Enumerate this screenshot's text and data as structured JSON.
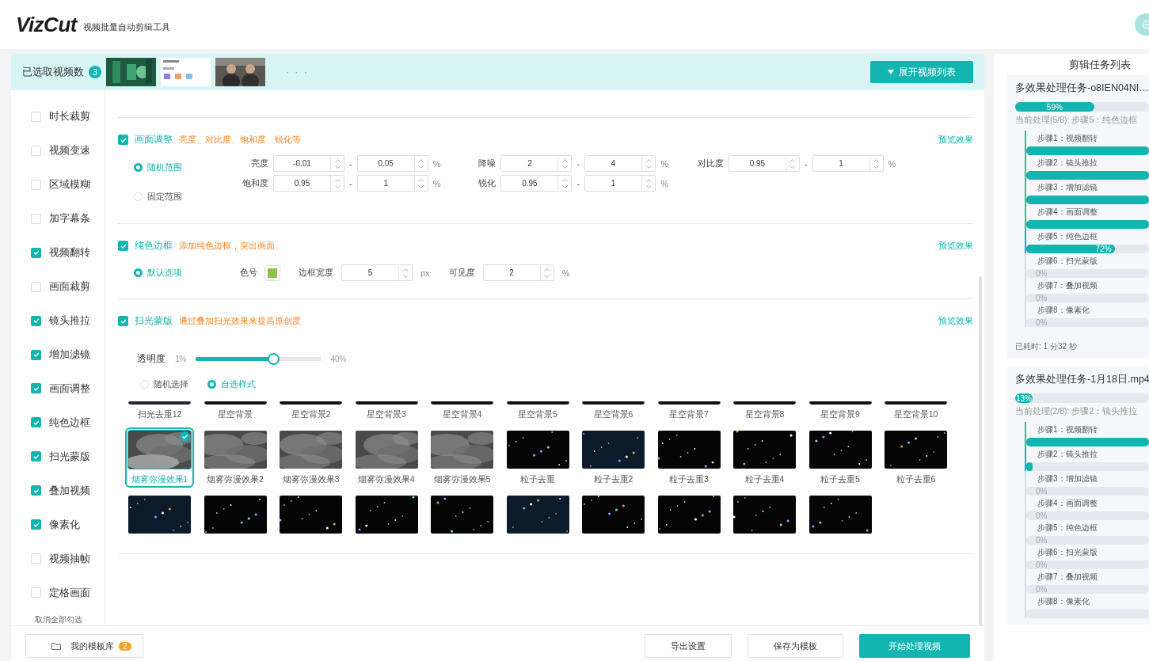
{
  "header": {
    "logo": "VizCut",
    "subtitle": "视频批量自动剪辑工具"
  },
  "selected_bar": {
    "label": "已选取视频数",
    "count": "3",
    "more": "· · ·",
    "expand_button": "展开视频列表"
  },
  "sidebar": {
    "items": [
      {
        "label": "时长裁剪",
        "checked": false
      },
      {
        "label": "视频变速",
        "checked": false
      },
      {
        "label": "区域模糊",
        "checked": false
      },
      {
        "label": "加字幕条",
        "checked": false
      },
      {
        "label": "视频翻转",
        "checked": true
      },
      {
        "label": "画面裁剪",
        "checked": false
      },
      {
        "label": "镜头推拉",
        "checked": true
      },
      {
        "label": "增加滤镜",
        "checked": true
      },
      {
        "label": "画面调整",
        "checked": true
      },
      {
        "label": "纯色边框",
        "checked": true
      },
      {
        "label": "扫光蒙版",
        "checked": true
      },
      {
        "label": "叠加视频",
        "checked": true
      },
      {
        "label": "像素化",
        "checked": true
      },
      {
        "label": "视频抽帧",
        "checked": false
      },
      {
        "label": "定格画面",
        "checked": false
      }
    ],
    "clear_all": "取消全部勾选"
  },
  "sections": [
    {
      "kind": "adjust",
      "checked": true,
      "title": "画面调整",
      "description": "亮度、对比度、饱和度、锐化等",
      "preview": "预览效果",
      "modes": [
        {
          "label": "随机范围",
          "selected": true
        },
        {
          "label": "固定范围",
          "selected": false
        }
      ],
      "params": [
        {
          "label": "亮度",
          "min": "-0.01",
          "separator": "-",
          "max": "0.05",
          "unit": "%"
        },
        {
          "label": "降噪",
          "min": "2",
          "separator": "-",
          "max": "4",
          "unit": "%"
        },
        {
          "label": "对比度",
          "min": "0.95",
          "separator": "-",
          "max": "1",
          "unit": "%"
        },
        {
          "label": "饱和度",
          "min": "0.95",
          "separator": "-",
          "max": "1",
          "unit": "%"
        },
        {
          "label": "锐化",
          "min": "0.95",
          "separator": "-",
          "max": "1",
          "unit": "%"
        }
      ]
    },
    {
      "kind": "border",
      "checked": true,
      "title": "纯色边框",
      "description": "添加纯色边框，突出画面",
      "preview": "预览效果",
      "modes": [
        {
          "label": "默认选项",
          "selected": true
        }
      ],
      "swatch": {
        "label": "色号",
        "color": "#8bc34a"
      },
      "fields": [
        {
          "label": "边框宽度",
          "value": "5",
          "unit": "px"
        },
        {
          "label": "可见度",
          "value": "2",
          "unit": "%"
        }
      ]
    },
    {
      "kind": "sweep",
      "checked": true,
      "title": "扫光蒙版",
      "description": "通过叠加扫光效果来提高原创度",
      "preview": "预览效果",
      "opacity": {
        "label": "透明度",
        "min": "1%",
        "max": "40%",
        "level": 0.62
      },
      "modes": [
        {
          "label": "随机选择",
          "selected": false
        },
        {
          "label": "自选样式",
          "selected": true
        }
      ],
      "styles": [
        {
          "kind": "cut",
          "label": "扫光去重12",
          "selected": false
        },
        {
          "kind": "cut",
          "label": "星空背景",
          "selected": false
        },
        {
          "kind": "cut",
          "label": "星空背景2",
          "selected": false
        },
        {
          "kind": "cut",
          "label": "星空背景3",
          "selected": false
        },
        {
          "kind": "cut",
          "label": "星空背景4",
          "selected": false
        },
        {
          "kind": "cut",
          "label": "星空背景5",
          "selected": false
        },
        {
          "kind": "cut",
          "label": "星空背景6",
          "selected": false
        },
        {
          "kind": "cut",
          "label": "星空背景7",
          "selected": false
        },
        {
          "kind": "cut",
          "label": "星空背景8",
          "selected": false
        },
        {
          "kind": "cut",
          "label": "星空背景9",
          "selected": false
        },
        {
          "kind": "cut",
          "label": "星空背景10",
          "selected": false
        },
        {
          "kind": "smoke",
          "label": "烟雾弥漫效果1",
          "selected": true
        },
        {
          "kind": "smoke",
          "label": "烟雾弥漫效果2",
          "selected": false
        },
        {
          "kind": "smoke",
          "label": "烟雾弥漫效果3",
          "selected": false
        },
        {
          "kind": "smoke",
          "label": "烟雾弥漫效果4",
          "selected": false
        },
        {
          "kind": "smoke",
          "label": "烟雾弥漫效果5",
          "selected": false
        },
        {
          "kind": "stars",
          "label": "粒子去重",
          "selected": false
        },
        {
          "kind": "stars",
          "label": "粒子去重2",
          "selected": false
        },
        {
          "kind": "stars",
          "label": "粒子去重3",
          "selected": false
        },
        {
          "kind": "stars",
          "label": "粒子去重4",
          "selected": false
        },
        {
          "kind": "stars",
          "label": "粒子去重5",
          "selected": false
        },
        {
          "kind": "stars",
          "label": "粒子去重6",
          "selected": false
        },
        {
          "kind": "stars",
          "selected": false
        },
        {
          "kind": "stars",
          "selected": false
        },
        {
          "kind": "stars",
          "selected": false
        },
        {
          "kind": "stars",
          "selected": false
        },
        {
          "kind": "stars",
          "selected": false
        },
        {
          "kind": "stars",
          "selected": false
        },
        {
          "kind": "stars",
          "selected": false
        },
        {
          "kind": "stars",
          "selected": false
        },
        {
          "kind": "stars",
          "selected": false
        },
        {
          "kind": "stars",
          "selected": false
        }
      ]
    }
  ],
  "bottom_bar": {
    "templates": {
      "label": "我的模板库",
      "count": "2"
    },
    "buttons": [
      {
        "label": "导出设置",
        "kind": "default"
      },
      {
        "label": "保存为模板",
        "kind": "default"
      },
      {
        "label": "开始处理视频",
        "kind": "primary"
      }
    ]
  },
  "task_panel": {
    "title": "剪辑任务列表",
    "tasks": [
      {
        "name": "多效果处理任务-o8IEN04NI…",
        "progress": {
          "level": 0.59,
          "reading": "59%"
        },
        "current": "当前处理(5/8): 步骤5：纯色边框",
        "steps": [
          {
            "label": "步骤1：视频翻转",
            "kind": "done",
            "level": 1
          },
          {
            "label": "步骤2：镜头推拉",
            "kind": "done",
            "level": 1
          },
          {
            "label": "步骤3：增加滤镜",
            "kind": "done",
            "level": 1
          },
          {
            "label": "步骤4：画面调整",
            "kind": "done",
            "level": 1
          },
          {
            "label": "步骤5：纯色边框",
            "kind": "active",
            "level": 0.72,
            "reading": "72%"
          },
          {
            "label": "步骤6：扫光蒙版",
            "kind": "pending",
            "level": 0,
            "reading": "0%"
          },
          {
            "label": "步骤7：叠加视频",
            "kind": "pending",
            "level": 0,
            "reading": "0%"
          },
          {
            "label": "步骤8：像素化",
            "kind": "pending",
            "level": 0,
            "reading": "0%"
          }
        ],
        "elapsed": "已耗时: 1 分32 秒"
      },
      {
        "name": "多效果处理任务-1月18日.mp4",
        "progress": {
          "level": 0.13,
          "reading": "13%"
        },
        "current": "当前处理(2/8): 步骤2：镜头推拉",
        "steps": [
          {
            "label": "步骤1：视频翻转",
            "kind": "done",
            "level": 1
          },
          {
            "label": "步骤2：镜头推拉",
            "kind": "active",
            "level": 0.01
          },
          {
            "label": "步骤3：增加滤镜",
            "kind": "pending",
            "level": 0,
            "reading": "0%"
          },
          {
            "label": "步骤4：画面调整",
            "kind": "pending",
            "level": 0,
            "reading": "0%"
          },
          {
            "label": "步骤5：纯色边框",
            "kind": "pending",
            "level": 0,
            "reading": "0%"
          },
          {
            "label": "步骤6：扫光蒙版",
            "kind": "pending",
            "level": 0,
            "reading": "0%"
          },
          {
            "label": "步骤7：叠加视频",
            "kind": "pending",
            "level": 0,
            "reading": "0%"
          },
          {
            "label": "步骤8：像素化",
            "kind": "pending",
            "level": 0
          }
        ]
      }
    ]
  }
}
